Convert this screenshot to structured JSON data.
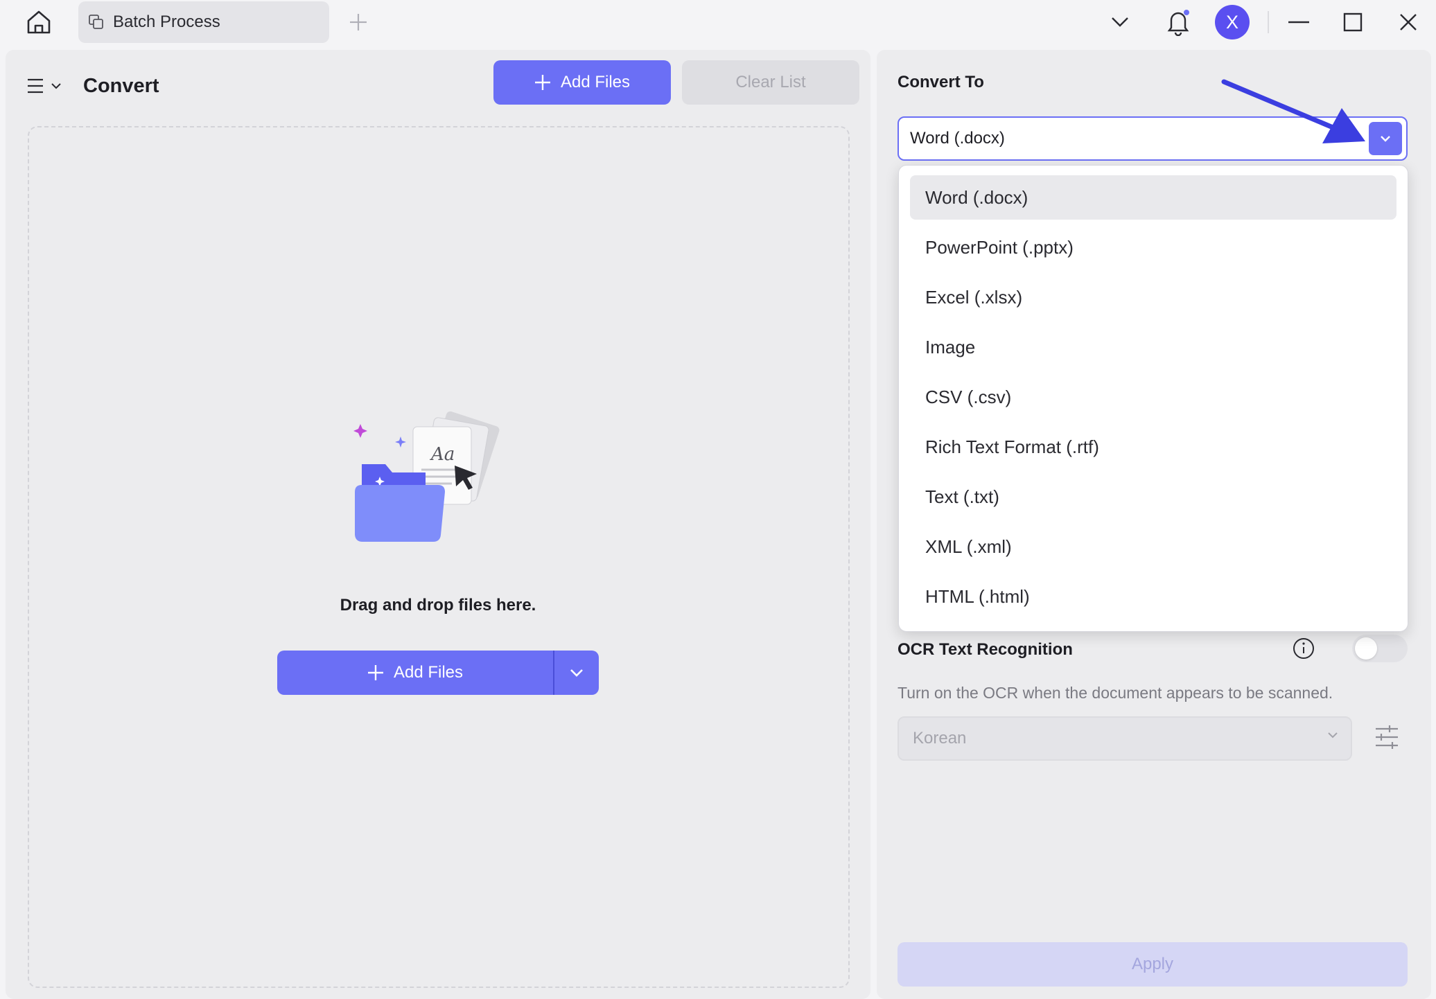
{
  "titlebar": {
    "tab_label": "Batch Process",
    "avatar_letter": "X"
  },
  "left_panel": {
    "title": "Convert",
    "add_files_label": "Add Files",
    "clear_list_label": "Clear List",
    "drop_text": "Drag and drop files here.",
    "add_files_split_label": "Add Files",
    "illustration_text": "Aa"
  },
  "right_panel": {
    "convert_to_label": "Convert To",
    "selected_format": "Word (.docx)",
    "format_options": [
      "Word (.docx)",
      "PowerPoint (.pptx)",
      "Excel (.xlsx)",
      "Image",
      "CSV (.csv)",
      "Rich Text Format (.rtf)",
      "Text (.txt)",
      "XML (.xml)",
      "HTML (.html)"
    ],
    "ocr_title": "OCR Text Recognition",
    "ocr_enabled": false,
    "ocr_description": "Turn on the OCR when the document appears to be scanned.",
    "ocr_language": "Korean",
    "apply_label": "Apply"
  },
  "colors": {
    "accent": "#6b6ff5",
    "annotation_arrow": "#3b3ee0",
    "avatar": "#5a4ff0"
  },
  "icons": [
    "home-icon",
    "tab-copy-icon",
    "plus-icon",
    "chevron-down-icon",
    "bell-icon",
    "minimize-icon",
    "maximize-icon",
    "close-icon",
    "hamburger-icon",
    "info-icon",
    "adjust-sliders-icon"
  ]
}
